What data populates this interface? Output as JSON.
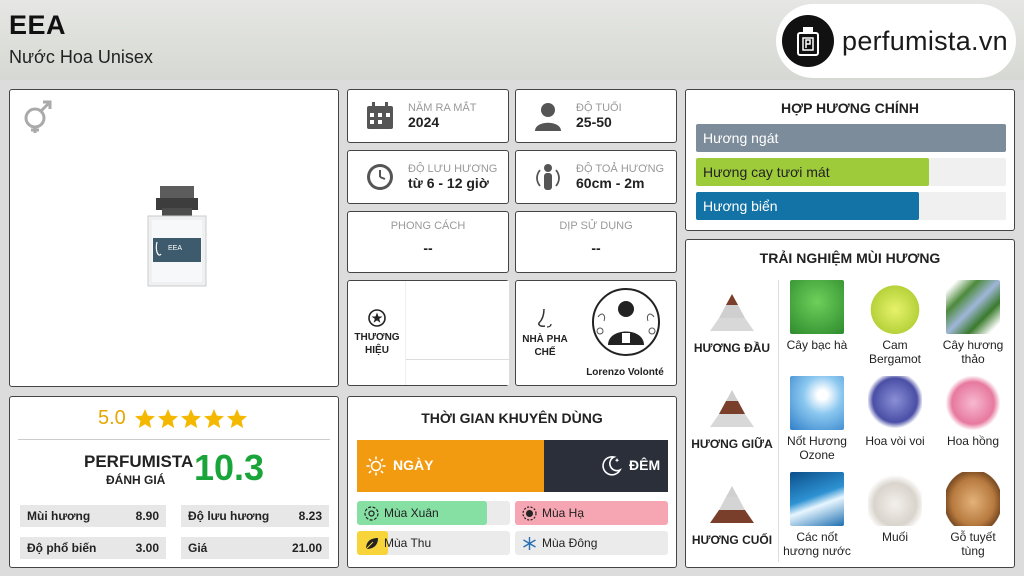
{
  "header": {
    "title": "EEA",
    "subtitle": "Nước Hoa Unisex",
    "logo_text": "perfumista.vn"
  },
  "info": {
    "launch_label": "NĂM RA MẮT",
    "launch_value": "2024",
    "age_label": "ĐỘ TUỔI",
    "age_value": "25-50",
    "longevity_label": "ĐỘ LƯU HƯƠNG",
    "longevity_value": "từ 6 - 12 giờ",
    "sillage_label": "ĐỘ TOẢ HƯƠNG",
    "sillage_value": "60cm - 2m",
    "style_label": "PHONG CÁCH",
    "style_value": "--",
    "occasion_label": "DỊP SỬ DỤNG",
    "occasion_value": "--",
    "brand_label": "THƯƠNG HIỆU",
    "perfumer_label": "NHÀ PHA CHẾ",
    "perfumer_name": "Lorenzo Volonté"
  },
  "rating": {
    "stars_value": "5.0",
    "stars": 5,
    "brand": "PERFUMISTA",
    "brand_sub": "ĐÁNH GIÁ",
    "score": "10.3",
    "scores": [
      {
        "label": "Mùi hương",
        "value": "8.90"
      },
      {
        "label": "Độ lưu hương",
        "value": "8.23"
      },
      {
        "label": "Độ phổ biến",
        "value": "3.00"
      },
      {
        "label": "Giá",
        "value": "21.00"
      }
    ]
  },
  "usage": {
    "title": "THỜI GIAN KHUYÊN DÙNG",
    "day_label": "NGÀY",
    "night_label": "ĐÊM",
    "day_fraction": 0.6,
    "seasons": [
      {
        "label": "Mùa Xuân",
        "fill": 0.85,
        "color": "#86e0a4"
      },
      {
        "label": "Mùa Hạ",
        "fill": 1.0,
        "color": "#f6a5b3"
      },
      {
        "label": "Mùa Thu",
        "fill": 0.2,
        "color": "#f6d43a"
      },
      {
        "label": "Mùa Đông",
        "fill": 0.0,
        "color": "#9fc7ee"
      }
    ]
  },
  "accords": {
    "title": "HỢP HƯƠNG CHÍNH",
    "items": [
      {
        "label": "Hương ngát",
        "fill": 1.0,
        "color": "#7d8c9b"
      },
      {
        "label": "Hương cay tươi mát",
        "fill": 0.75,
        "color": "#9ecb3a"
      },
      {
        "label": "Hương biển",
        "fill": 0.72,
        "color": "#1373a6"
      }
    ]
  },
  "notes": {
    "title": "TRẢI NGHIỆM MÙI HƯƠNG",
    "top_label": "HƯƠNG ĐẦU",
    "mid_label": "HƯƠNG GIỮA",
    "base_label": "HƯƠNG CUỐI",
    "top": [
      "Cây bạc hà",
      "Cam Bergamot",
      "Cây hương thảo"
    ],
    "mid": [
      "Nốt Hương Ozone",
      "Hoa vòi voi",
      "Hoa hồng"
    ],
    "base": [
      "Các nốt hương nước",
      "Muối",
      "Gỗ tuyết tùng"
    ]
  },
  "colors": {
    "day": "#f29a10",
    "night": "#2a2f3a",
    "score_green": "#1aa53a",
    "star": "#f5b800"
  }
}
